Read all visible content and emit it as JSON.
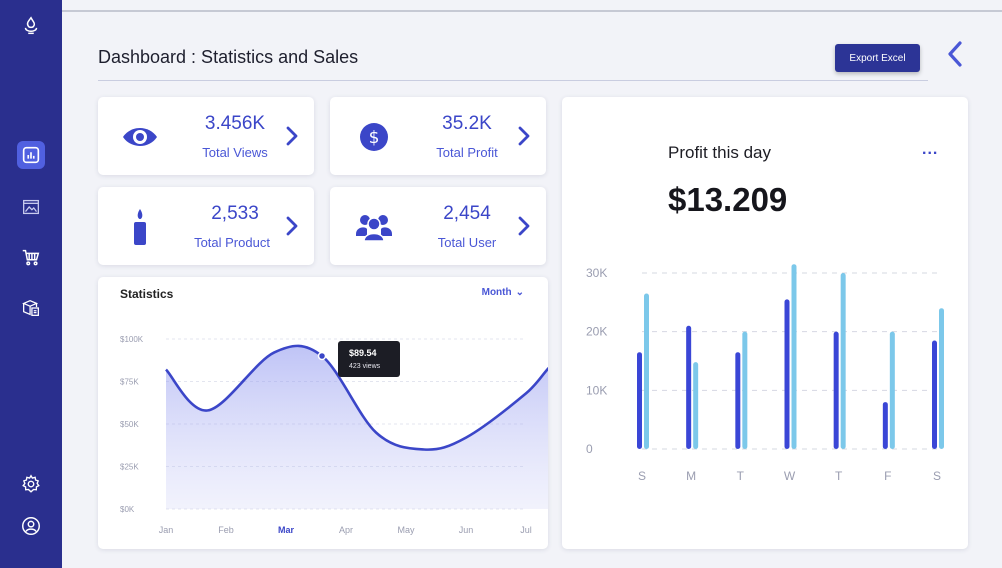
{
  "header": {
    "title": "Dashboard : Statistics and Sales",
    "export_label": "Export Excel"
  },
  "sidebar": {
    "items": [
      {
        "icon": "logo-icon"
      },
      {
        "icon": "chart-icon",
        "active": true
      },
      {
        "icon": "image-icon"
      },
      {
        "icon": "cart-icon"
      },
      {
        "icon": "package-icon"
      },
      {
        "icon": "gear-icon"
      },
      {
        "icon": "user-circle-icon"
      }
    ]
  },
  "stats": [
    {
      "value": "3.456K",
      "label": "Total Views",
      "icon": "eye-icon"
    },
    {
      "value": "35.2K",
      "label": "Total Profit",
      "icon": "dollar-icon"
    },
    {
      "value": "2,533",
      "label": "Total Product",
      "icon": "candle-icon"
    },
    {
      "value": "2,454",
      "label": "Total User",
      "icon": "users-icon"
    }
  ],
  "statistics_panel": {
    "title": "Statistics",
    "period": "Month",
    "tooltip_value": "$89.54",
    "tooltip_sub": "423 views"
  },
  "profit_panel": {
    "title": "Profit this day",
    "value": "$13.209",
    "menu": "..."
  },
  "colors": {
    "sidebar": "#2a2f8e",
    "accent": "#3b46c8",
    "bar_dark": "#3a46d6",
    "bar_light": "#7cc8ea"
  },
  "chart_data": [
    {
      "type": "area",
      "title": "Statistics",
      "categories": [
        "Jan",
        "Feb",
        "Mar",
        "Apr",
        "May",
        "Jun",
        "Jul"
      ],
      "highlight_category": "Mar",
      "y_ticks": [
        "$100K",
        "$75K",
        "$50K",
        "$25K",
        "$0K"
      ],
      "ylim": [
        0,
        100000
      ],
      "series": [
        {
          "x": [
            0,
            0.7,
            1.8,
            2.6,
            3.5,
            4.3,
            5.0,
            6.0,
            6.5,
            7.0
          ],
          "values": [
            82000,
            58000,
            92000,
            90000,
            45000,
            35000,
            42000,
            68000,
            86000,
            82000
          ]
        }
      ]
    },
    {
      "type": "bar",
      "categories": [
        "S",
        "M",
        "T",
        "W",
        "T",
        "F",
        "S"
      ],
      "y_ticks": [
        "30K",
        "20K",
        "10K",
        "0"
      ],
      "ylim": [
        0,
        30000
      ],
      "series": [
        {
          "values": [
            16500,
            21000,
            16500,
            25500,
            20000,
            8000,
            18500
          ]
        },
        {
          "values": [
            26500,
            14800,
            20000,
            31500,
            30000,
            20000,
            24000
          ]
        }
      ],
      "grid": true
    }
  ]
}
